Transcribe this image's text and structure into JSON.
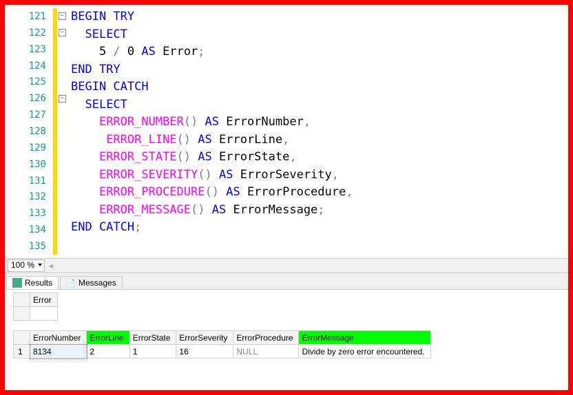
{
  "zoom": {
    "level": "100 %"
  },
  "tabs": [
    {
      "label": "Results",
      "icon": "grid"
    },
    {
      "label": "Messages",
      "icon": "msg"
    }
  ],
  "lines": [
    {
      "num": "121",
      "fold": "box",
      "tokens": [
        {
          "c": "kw",
          "t": "BEGIN TRY"
        }
      ]
    },
    {
      "num": "122",
      "fold": "box",
      "tokens": [
        {
          "c": "txt",
          "t": "  "
        },
        {
          "c": "kw",
          "t": "SELECT"
        }
      ]
    },
    {
      "num": "123",
      "fold": "line",
      "tokens": [
        {
          "c": "txt",
          "t": "    5 "
        },
        {
          "c": "punct",
          "t": "/"
        },
        {
          "c": "txt",
          "t": " 0 "
        },
        {
          "c": "kw",
          "t": "AS"
        },
        {
          "c": "txt",
          "t": " Error"
        },
        {
          "c": "punct",
          "t": ";"
        }
      ]
    },
    {
      "num": "124",
      "fold": "line",
      "tokens": [
        {
          "c": "kw",
          "t": "END TRY"
        }
      ]
    },
    {
      "num": "125",
      "fold": "line",
      "tokens": [
        {
          "c": "kw",
          "t": "BEGIN CATCH"
        }
      ]
    },
    {
      "num": "126",
      "fold": "box",
      "tokens": [
        {
          "c": "txt",
          "t": "  "
        },
        {
          "c": "kw",
          "t": "SELECT"
        }
      ]
    },
    {
      "num": "127",
      "fold": "line",
      "tokens": [
        {
          "c": "txt",
          "t": "    "
        },
        {
          "c": "fn",
          "t": "ERROR_NUMBER"
        },
        {
          "c": "punct",
          "t": "()"
        },
        {
          "c": "txt",
          "t": " "
        },
        {
          "c": "kw",
          "t": "AS"
        },
        {
          "c": "txt",
          "t": " ErrorNumber"
        },
        {
          "c": "punct",
          "t": ","
        }
      ]
    },
    {
      "num": "128",
      "fold": "line",
      "tokens": [
        {
          "c": "txt",
          "t": "     "
        },
        {
          "c": "fn",
          "t": "ERROR_LINE"
        },
        {
          "c": "punct",
          "t": "()"
        },
        {
          "c": "txt",
          "t": " "
        },
        {
          "c": "kw",
          "t": "AS"
        },
        {
          "c": "txt",
          "t": " ErrorLine"
        },
        {
          "c": "punct",
          "t": ","
        }
      ]
    },
    {
      "num": "129",
      "fold": "line",
      "tokens": [
        {
          "c": "txt",
          "t": "    "
        },
        {
          "c": "fn",
          "t": "ERROR_STATE"
        },
        {
          "c": "punct",
          "t": "()"
        },
        {
          "c": "txt",
          "t": " "
        },
        {
          "c": "kw",
          "t": "AS"
        },
        {
          "c": "txt",
          "t": " ErrorState"
        },
        {
          "c": "punct",
          "t": ","
        }
      ]
    },
    {
      "num": "130",
      "fold": "line",
      "tokens": [
        {
          "c": "txt",
          "t": "    "
        },
        {
          "c": "fn",
          "t": "ERROR_SEVERITY"
        },
        {
          "c": "punct",
          "t": "()"
        },
        {
          "c": "txt",
          "t": " "
        },
        {
          "c": "kw",
          "t": "AS"
        },
        {
          "c": "txt",
          "t": " ErrorSeverity"
        },
        {
          "c": "punct",
          "t": ","
        }
      ]
    },
    {
      "num": "131",
      "fold": "line",
      "tokens": [
        {
          "c": "txt",
          "t": "    "
        },
        {
          "c": "fn",
          "t": "ERROR_PROCEDURE"
        },
        {
          "c": "punct",
          "t": "()"
        },
        {
          "c": "txt",
          "t": " "
        },
        {
          "c": "kw",
          "t": "AS"
        },
        {
          "c": "txt",
          "t": " ErrorProcedure"
        },
        {
          "c": "punct",
          "t": ","
        }
      ]
    },
    {
      "num": "132",
      "fold": "line",
      "tokens": [
        {
          "c": "txt",
          "t": "    "
        },
        {
          "c": "fn",
          "t": "ERROR_MESSAGE"
        },
        {
          "c": "punct",
          "t": "()"
        },
        {
          "c": "txt",
          "t": " "
        },
        {
          "c": "kw",
          "t": "AS"
        },
        {
          "c": "txt",
          "t": " ErrorMessage"
        },
        {
          "c": "punct",
          "t": ";"
        }
      ]
    },
    {
      "num": "133",
      "fold": "line",
      "tokens": [
        {
          "c": "kw",
          "t": "END CATCH"
        },
        {
          "c": "punct",
          "t": ";"
        }
      ]
    },
    {
      "num": "134",
      "fold": "none",
      "tokens": []
    },
    {
      "num": "135",
      "fold": "none",
      "tokens": []
    }
  ],
  "grids": [
    {
      "columns": [
        {
          "name": "Error"
        }
      ],
      "rows": []
    },
    {
      "columns": [
        {
          "name": "ErrorNumber"
        },
        {
          "name": "ErrorLine",
          "hl": true
        },
        {
          "name": "ErrorState"
        },
        {
          "name": "ErrorSeverity"
        },
        {
          "name": "ErrorProcedure"
        },
        {
          "name": "ErrorMessage",
          "hl": true
        }
      ],
      "rows": [
        {
          "n": "1",
          "cells": [
            {
              "v": "8134",
              "sel": true
            },
            {
              "v": "2"
            },
            {
              "v": "1"
            },
            {
              "v": "16"
            },
            {
              "v": "NULL",
              "null": true
            },
            {
              "v": "Divide by zero error encountered."
            }
          ]
        }
      ]
    }
  ]
}
